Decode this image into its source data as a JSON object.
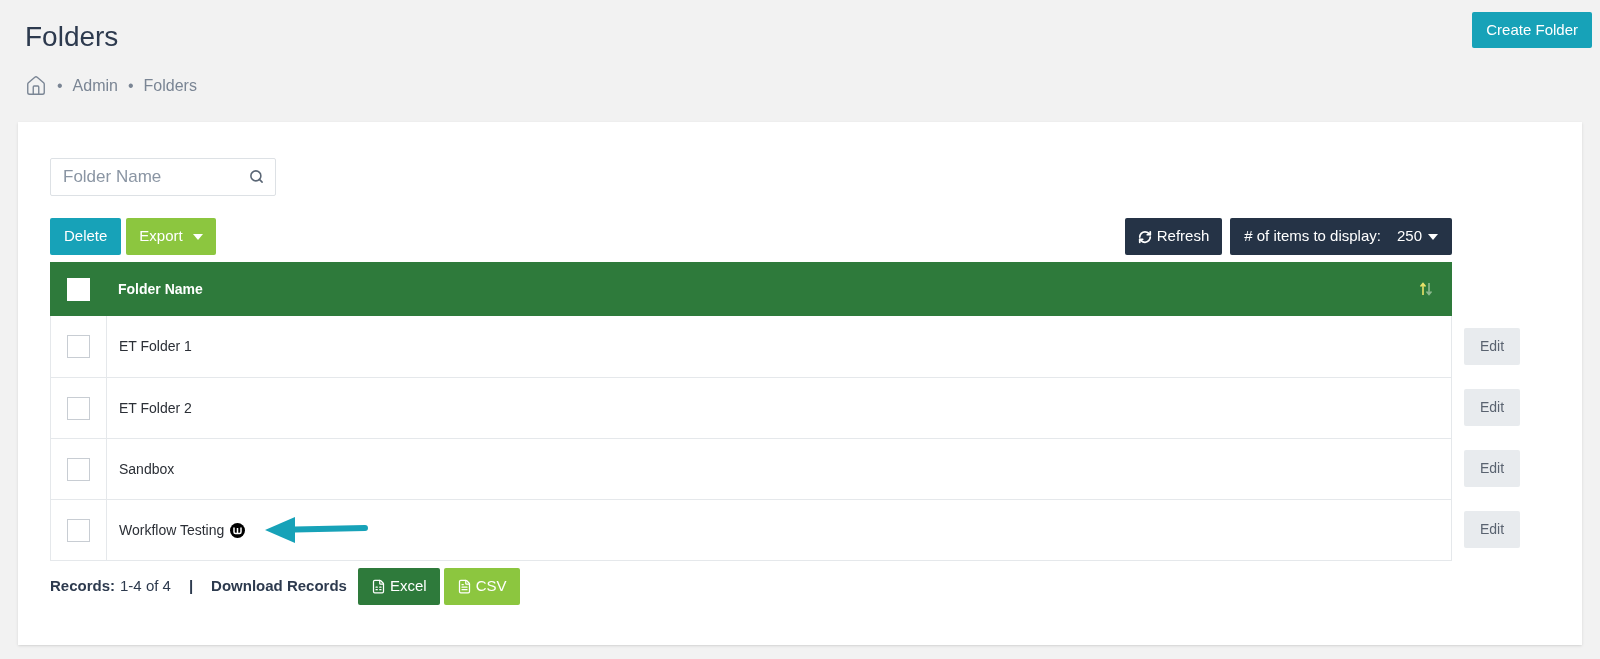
{
  "page": {
    "title": "Folders",
    "create_button": "Create Folder"
  },
  "breadcrumb": [
    {
      "separator": "•",
      "label": "Admin"
    },
    {
      "separator": "•",
      "label": "Folders"
    }
  ],
  "search": {
    "placeholder": "Folder Name"
  },
  "toolbar": {
    "delete": "Delete",
    "export": "Export",
    "refresh": "Refresh",
    "items_label": "# of items to display:",
    "items_value": "250"
  },
  "table": {
    "header_checked": false,
    "columns": [
      "Folder Name"
    ],
    "rows": [
      {
        "name": "ET Folder 1",
        "checked": false,
        "badge": false,
        "edit": "Edit"
      },
      {
        "name": "ET Folder 2",
        "checked": false,
        "badge": false,
        "edit": "Edit"
      },
      {
        "name": "Sandbox",
        "checked": false,
        "badge": false,
        "edit": "Edit"
      },
      {
        "name": "Workflow Testing",
        "checked": false,
        "badge": true,
        "arrow": true,
        "edit": "Edit"
      }
    ]
  },
  "footer": {
    "records_label": "Records:",
    "records_value": "1-4 of 4",
    "separator": "|",
    "download": "Download Records",
    "excel": "Excel",
    "csv": "CSV"
  }
}
